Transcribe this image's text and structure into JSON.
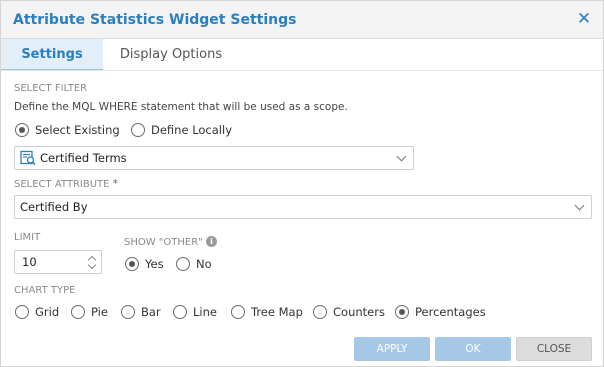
{
  "dialog": {
    "title": "Attribute Statistics Widget Settings",
    "close_icon": "close-icon"
  },
  "tabs": [
    {
      "label": "Settings",
      "active": true
    },
    {
      "label": "Display Options",
      "active": false
    }
  ],
  "filter": {
    "section_label": "SELECT FILTER",
    "description": "Define the MQL WHERE statement that will be used as a scope.",
    "options": [
      {
        "label": "Select Existing",
        "checked": true
      },
      {
        "label": "Define Locally",
        "checked": false
      }
    ],
    "selected": "Certified Terms",
    "icon": "filter-icon"
  },
  "attribute": {
    "section_label": "SELECT ATTRIBUTE",
    "required_mark": "*",
    "selected": "Certified By"
  },
  "limit": {
    "section_label": "LIMIT",
    "value": "10"
  },
  "show_other": {
    "section_label": "SHOW \"OTHER\"",
    "info_icon": "info-icon",
    "options": [
      {
        "label": "Yes",
        "checked": true
      },
      {
        "label": "No",
        "checked": false
      }
    ]
  },
  "chart_type": {
    "section_label": "CHART TYPE",
    "options": [
      {
        "label": "Grid",
        "checked": false
      },
      {
        "label": "Pie",
        "checked": false
      },
      {
        "label": "Bar",
        "checked": false
      },
      {
        "label": "Line",
        "checked": false
      },
      {
        "label": "Tree Map",
        "checked": false
      },
      {
        "label": "Counters",
        "checked": false
      },
      {
        "label": "Percentages",
        "checked": true
      }
    ]
  },
  "buttons": {
    "apply": "APPLY",
    "ok": "OK",
    "close": "CLOSE"
  },
  "colors": {
    "accent": "#2a7fc1",
    "primary_button": "#a7c7e6",
    "active_tab_bg": "#e2eef8"
  }
}
